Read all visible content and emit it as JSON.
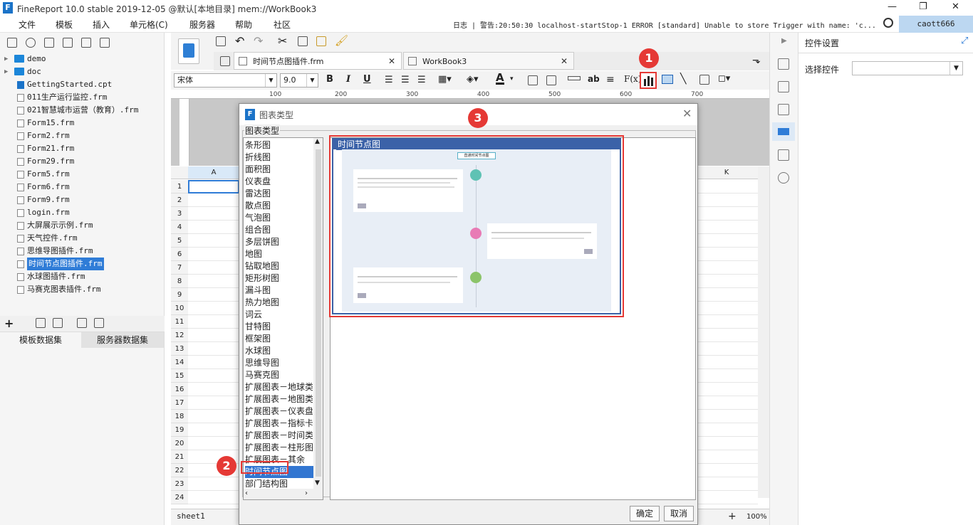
{
  "window": {
    "title": "FineReport 10.0 stable 2019-12-05 @默认[本地目录]     mem://WorkBook3",
    "controls": [
      "—",
      "❐",
      "✕"
    ]
  },
  "menu": [
    "文件",
    "模板",
    "插入",
    "单元格(C)",
    "服务器",
    "帮助",
    "社区"
  ],
  "log": "日志 | 警告:20:50:30 localhost-startStop-1 ERROR [standard] Unable to store Trigger with name: 'c...",
  "user": "caott666",
  "file_tree": [
    {
      "name": "demo",
      "type": "folder"
    },
    {
      "name": "doc",
      "type": "folder"
    },
    {
      "name": "GettingStarted.cpt",
      "type": "cpt"
    },
    {
      "name": "011生产运行监控.frm",
      "type": "frm"
    },
    {
      "name": "021智慧城市运营（教育）.frm",
      "type": "frm"
    },
    {
      "name": "Form15.frm",
      "type": "frm"
    },
    {
      "name": "Form2.frm",
      "type": "frm"
    },
    {
      "name": "Form21.frm",
      "type": "frm"
    },
    {
      "name": "Form29.frm",
      "type": "frm"
    },
    {
      "name": "Form5.frm",
      "type": "frm"
    },
    {
      "name": "Form6.frm",
      "type": "frm"
    },
    {
      "name": "Form9.frm",
      "type": "frm"
    },
    {
      "name": "login.frm",
      "type": "frm"
    },
    {
      "name": "大屏展示示例.frm",
      "type": "frm"
    },
    {
      "name": "天气控件.frm",
      "type": "frm"
    },
    {
      "name": "思维导图插件.frm",
      "type": "frm"
    },
    {
      "name": "时间节点图插件.frm",
      "type": "frm",
      "selected": true
    },
    {
      "name": "水球图插件.frm",
      "type": "frm"
    },
    {
      "name": "马赛克图表插件.frm",
      "type": "frm"
    }
  ],
  "dataset_tabs": [
    "模板数据集",
    "服务器数据集"
  ],
  "file_tabs": [
    "时间节点图插件.frm",
    "WorkBook3"
  ],
  "font": {
    "name": "宋体",
    "size": "9.0"
  },
  "ruler_marks": [
    "100",
    "200",
    "300",
    "400",
    "500",
    "600",
    "700"
  ],
  "columns": [
    "A",
    "K"
  ],
  "rows": [
    "1",
    "2",
    "3",
    "4",
    "5",
    "6",
    "7",
    "8",
    "9",
    "10",
    "11",
    "12",
    "13",
    "14",
    "15",
    "16",
    "17",
    "18",
    "19",
    "20",
    "21",
    "22",
    "23",
    "24"
  ],
  "sheet_tab": "sheet1",
  "zoom": "100%",
  "right_panel": {
    "title": "控件设置",
    "select_label": "选择控件"
  },
  "dialog": {
    "title": "图表类型",
    "group_label": "图表类型",
    "chart_types": [
      "条形图",
      "折线图",
      "面积图",
      "仪表盘",
      "雷达图",
      "散点图",
      "气泡图",
      "组合图",
      "多层饼图",
      "地图",
      "钻取地图",
      "矩形树图",
      "漏斗图",
      "热力地图",
      "词云",
      "甘特图",
      "框架图",
      "水球图",
      "思维导图",
      "马赛克图",
      "扩展图表－地球类",
      "扩展图表－地图类",
      "扩展图表－仪表盘",
      "扩展图表－指标卡",
      "扩展图表－时间类",
      "扩展图表－柱形图",
      "扩展图表－其余",
      "时间节点图",
      "部门结构图"
    ],
    "selected": "时间节点图",
    "preview_title": "时间节点图",
    "preview_header": "直通时间节点图",
    "ok": "确定",
    "cancel": "取消"
  },
  "annotations": [
    "1",
    "2",
    "3"
  ],
  "colors": {
    "accent": "#2f7cd7",
    "annotation": "#e53935",
    "preview_blue": "#3b62a8"
  }
}
